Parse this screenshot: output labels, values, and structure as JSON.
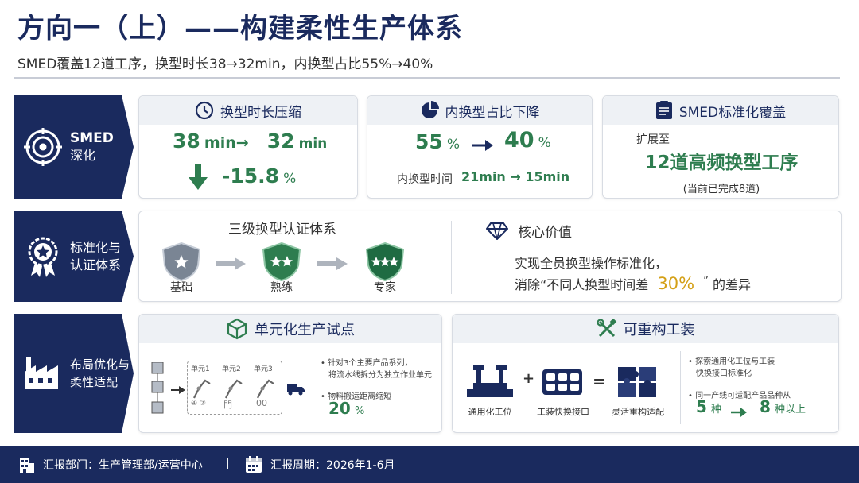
{
  "header": {
    "title": "方向一（上）——构建柔性生产体系",
    "subtitle": "SMED覆盖12道工序，换型时长38→32min，内换型占比55%→40%"
  },
  "row1": {
    "label_line1": "SMED",
    "label_line2": "深化",
    "card1": {
      "title": "换型时长压缩",
      "from_value": "38",
      "from_unit": "min→",
      "to_value": "32",
      "to_unit": "min",
      "change_value": "-15.8",
      "change_unit": "%"
    },
    "card2": {
      "title": "内换型占比下降",
      "from_value": "55",
      "from_unit": "%",
      "to_value": "40",
      "to_unit": "%",
      "detail_label": "内换型时间",
      "detail_value": "21min → 15min"
    },
    "card3": {
      "title": "SMED标准化覆盖",
      "prefix": "扩展至",
      "headline": "12道高频换型工序",
      "note": "(当前已完成8道)"
    }
  },
  "row2": {
    "label_line1": "标准化与",
    "label_line2": "认证体系",
    "cert_title": "三级换型认证体系",
    "levels": [
      "基础",
      "熟练",
      "专家"
    ],
    "value_title": "核心价值",
    "value_line1": "实现全员换型操作标准化，",
    "value_line2_pre": "消除“不同人换型时间差",
    "value_highlight": "30%",
    "value_line2_post": "的差异",
    "value_quote": "”"
  },
  "row3": {
    "label_line1": "布局优化与",
    "label_line2": "柔性适配",
    "cell_panel": {
      "title": "单元化生产试点",
      "units": [
        "单元1",
        "单元2",
        "单元3"
      ],
      "unit_marks": [
        "④ ⑦",
        "門",
        "00"
      ],
      "bullet1_line1": "针对3个主要产品系列，",
      "bullet1_line2": "将流水线拆分为独立作业单元",
      "bullet2": "物料搬运距离缩短",
      "bullet2_value": "20",
      "bullet2_unit": "%"
    },
    "reconfig_panel": {
      "title": "可重构工装",
      "items": [
        "通用化工位",
        "工装快换接口",
        "灵活重构适配"
      ],
      "plus": "+",
      "equals": "=",
      "bullet1_line1": "探索通用化工位与工装",
      "bullet1_line2": "快换接口标准化",
      "bullet2": "同一产线可适配产品品种从",
      "from_value": "5",
      "from_unit": "种",
      "to_value": "8",
      "to_unit": "种以上"
    }
  },
  "footer": {
    "dept": "汇报部门：生产管理部/运营中心",
    "separator": "|",
    "period": "汇报周期：2026年1-6月"
  },
  "colors": {
    "navy": "#1a2a5e",
    "green": "#2e7d4f",
    "gold": "#d4a017"
  }
}
